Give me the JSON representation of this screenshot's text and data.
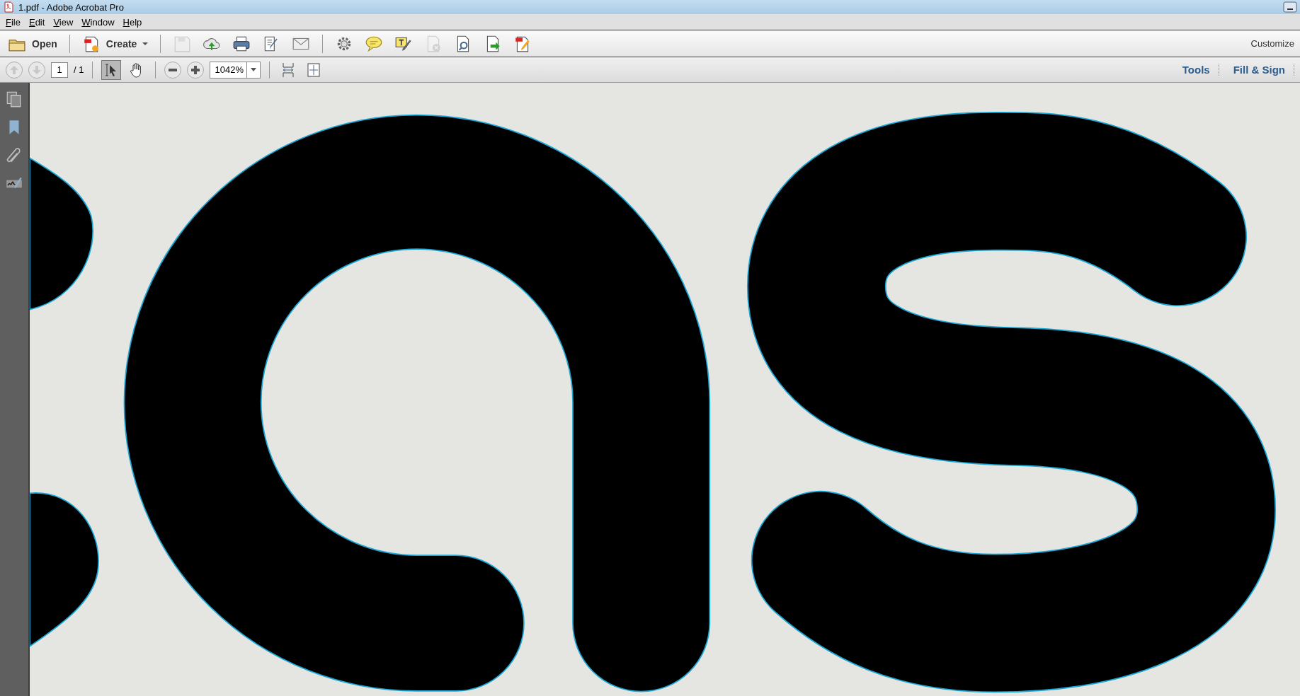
{
  "window": {
    "title": "1.pdf - Adobe Acrobat Pro"
  },
  "menu": [
    {
      "mnemonic": "F",
      "rest": "ile"
    },
    {
      "mnemonic": "E",
      "rest": "dit"
    },
    {
      "mnemonic": "V",
      "rest": "iew"
    },
    {
      "mnemonic": "W",
      "rest": "indow"
    },
    {
      "mnemonic": "H",
      "rest": "elp"
    }
  ],
  "toolbar": {
    "items": [
      {
        "kind": "folder",
        "label": "Open",
        "dropdown": false,
        "disabled": false
      },
      {
        "kind": "sep"
      },
      {
        "kind": "create",
        "label": "Create",
        "dropdown": true,
        "disabled": false
      },
      {
        "kind": "sep"
      },
      {
        "kind": "save",
        "disabled": true
      },
      {
        "kind": "cloud",
        "disabled": false
      },
      {
        "kind": "print",
        "disabled": false
      },
      {
        "kind": "edit",
        "disabled": false
      },
      {
        "kind": "mail",
        "disabled": false
      },
      {
        "kind": "sep"
      },
      {
        "kind": "gear",
        "disabled": false
      },
      {
        "kind": "comment",
        "disabled": false
      },
      {
        "kind": "sign",
        "disabled": false
      },
      {
        "kind": "doccancel",
        "disabled": true
      },
      {
        "kind": "docsearch",
        "disabled": false
      },
      {
        "kind": "docexport",
        "disabled": false
      },
      {
        "kind": "docedit",
        "disabled": false
      }
    ],
    "customize": "Customize"
  },
  "nav": {
    "prev_disabled": true,
    "next_disabled": true,
    "page": "1",
    "page_total": "/ 1",
    "select_tool_selected": true,
    "hand_tool_selected": false,
    "zoom": "1042%"
  },
  "panels": [
    {
      "label": "Tools"
    },
    {
      "label": "Fill & Sign"
    }
  ],
  "sidebar": [
    {
      "kind": "pages"
    },
    {
      "kind": "bookmark"
    },
    {
      "kind": "clip"
    },
    {
      "kind": "signature"
    }
  ]
}
